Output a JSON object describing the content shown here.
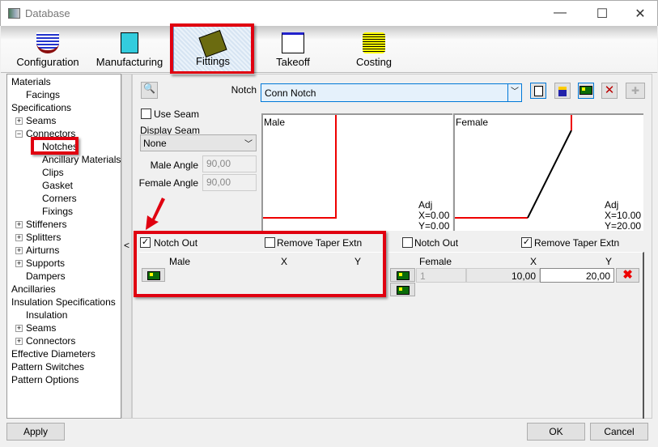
{
  "window": {
    "title": "Database",
    "minimize": "—",
    "maximize": "☐",
    "close": "✕"
  },
  "tabs": [
    {
      "label": "Configuration"
    },
    {
      "label": "Manufacturing"
    },
    {
      "label": "Fittings"
    },
    {
      "label": "Takeoff"
    },
    {
      "label": "Costing"
    }
  ],
  "tree": [
    "Materials",
    "Facings",
    "Specifications",
    "Seams",
    "Connectors",
    "Notches",
    "Ancillary Materials",
    "Clips",
    "Gasket",
    "Corners",
    "Fixings",
    "Stiffeners",
    "Splitters",
    "Airturns",
    "Supports",
    "Dampers",
    "Ancillaries",
    "Insulation Specifications",
    "Insulation",
    "Seams",
    "Connectors",
    "Effective Diameters",
    "Pattern Switches",
    "Pattern Options"
  ],
  "splitter_arrow": "<",
  "notch": {
    "label": "Notch",
    "value": "Conn Notch"
  },
  "use_seam": {
    "label": "Use Seam",
    "checked": false
  },
  "display_seam": {
    "label": "Display Seam",
    "value": "None"
  },
  "male_angle": {
    "label": "Male Angle",
    "value": "90,00"
  },
  "female_angle": {
    "label": "Female Angle",
    "value": "90,00"
  },
  "male_preview": {
    "title": "Male",
    "adj": "Adj",
    "x": "X=0.00",
    "y": "Y=0.00"
  },
  "female_preview": {
    "title": "Female",
    "adj": "Adj",
    "x": "X=10.00",
    "y": "Y=20.00"
  },
  "male_options": {
    "notch_out": "Notch Out",
    "notch_out_checked": true,
    "remove_taper": "Remove Taper Extn",
    "remove_taper_checked": false
  },
  "female_options": {
    "notch_out": "Notch Out",
    "notch_out_checked": false,
    "remove_taper": "Remove Taper Extn",
    "remove_taper_checked": true
  },
  "male_grid": {
    "headers": [
      "Male",
      "X",
      "Y"
    ]
  },
  "female_grid": {
    "headers": [
      "Female",
      "X",
      "Y"
    ],
    "rows": [
      {
        "index": "1",
        "x": "10,00",
        "y": "20,00"
      }
    ]
  },
  "buttons": {
    "apply": "Apply",
    "ok": "OK",
    "cancel": "Cancel"
  },
  "check_mark": "✓"
}
